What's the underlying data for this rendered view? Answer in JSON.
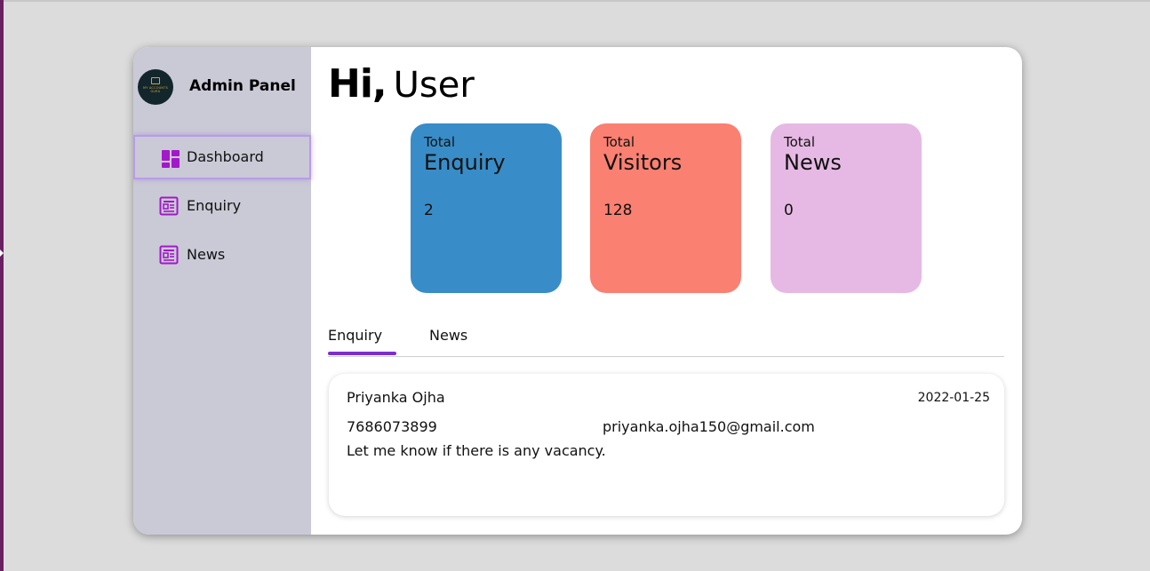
{
  "sidebar": {
    "title": "Admin Panel",
    "logo_text": "MY ACCOUNTS GURU",
    "items": [
      {
        "label": "Dashboard",
        "icon": "dashboard-icon",
        "active": true
      },
      {
        "label": "Enquiry",
        "icon": "newspaper-icon",
        "active": false
      },
      {
        "label": "News",
        "icon": "newspaper-icon",
        "active": false
      }
    ]
  },
  "header": {
    "greeting_bold": "Hi,",
    "greeting_name": "User"
  },
  "cards": [
    {
      "small": "Total",
      "big": "Enquiry",
      "value": "2",
      "color": "#388dc8"
    },
    {
      "small": "Total",
      "big": "Visitors",
      "value": "128",
      "color": "#fa8071"
    },
    {
      "small": "Total",
      "big": "News",
      "value": "0",
      "color": "#e6b9e4"
    }
  ],
  "tabs": [
    {
      "label": "Enquiry",
      "selected": true
    },
    {
      "label": "News",
      "selected": false
    }
  ],
  "enquiries": [
    {
      "name": "Priyanka Ojha",
      "date": "2022-01-25",
      "phone": "7686073899",
      "email": "priyanka.ojha150@gmail.com",
      "message": "Let me know if there is any vacancy."
    }
  ],
  "colors": {
    "accent": "#7a2fd0",
    "icon": "#a318c9",
    "sidebar_bg": "#c9cad6"
  }
}
